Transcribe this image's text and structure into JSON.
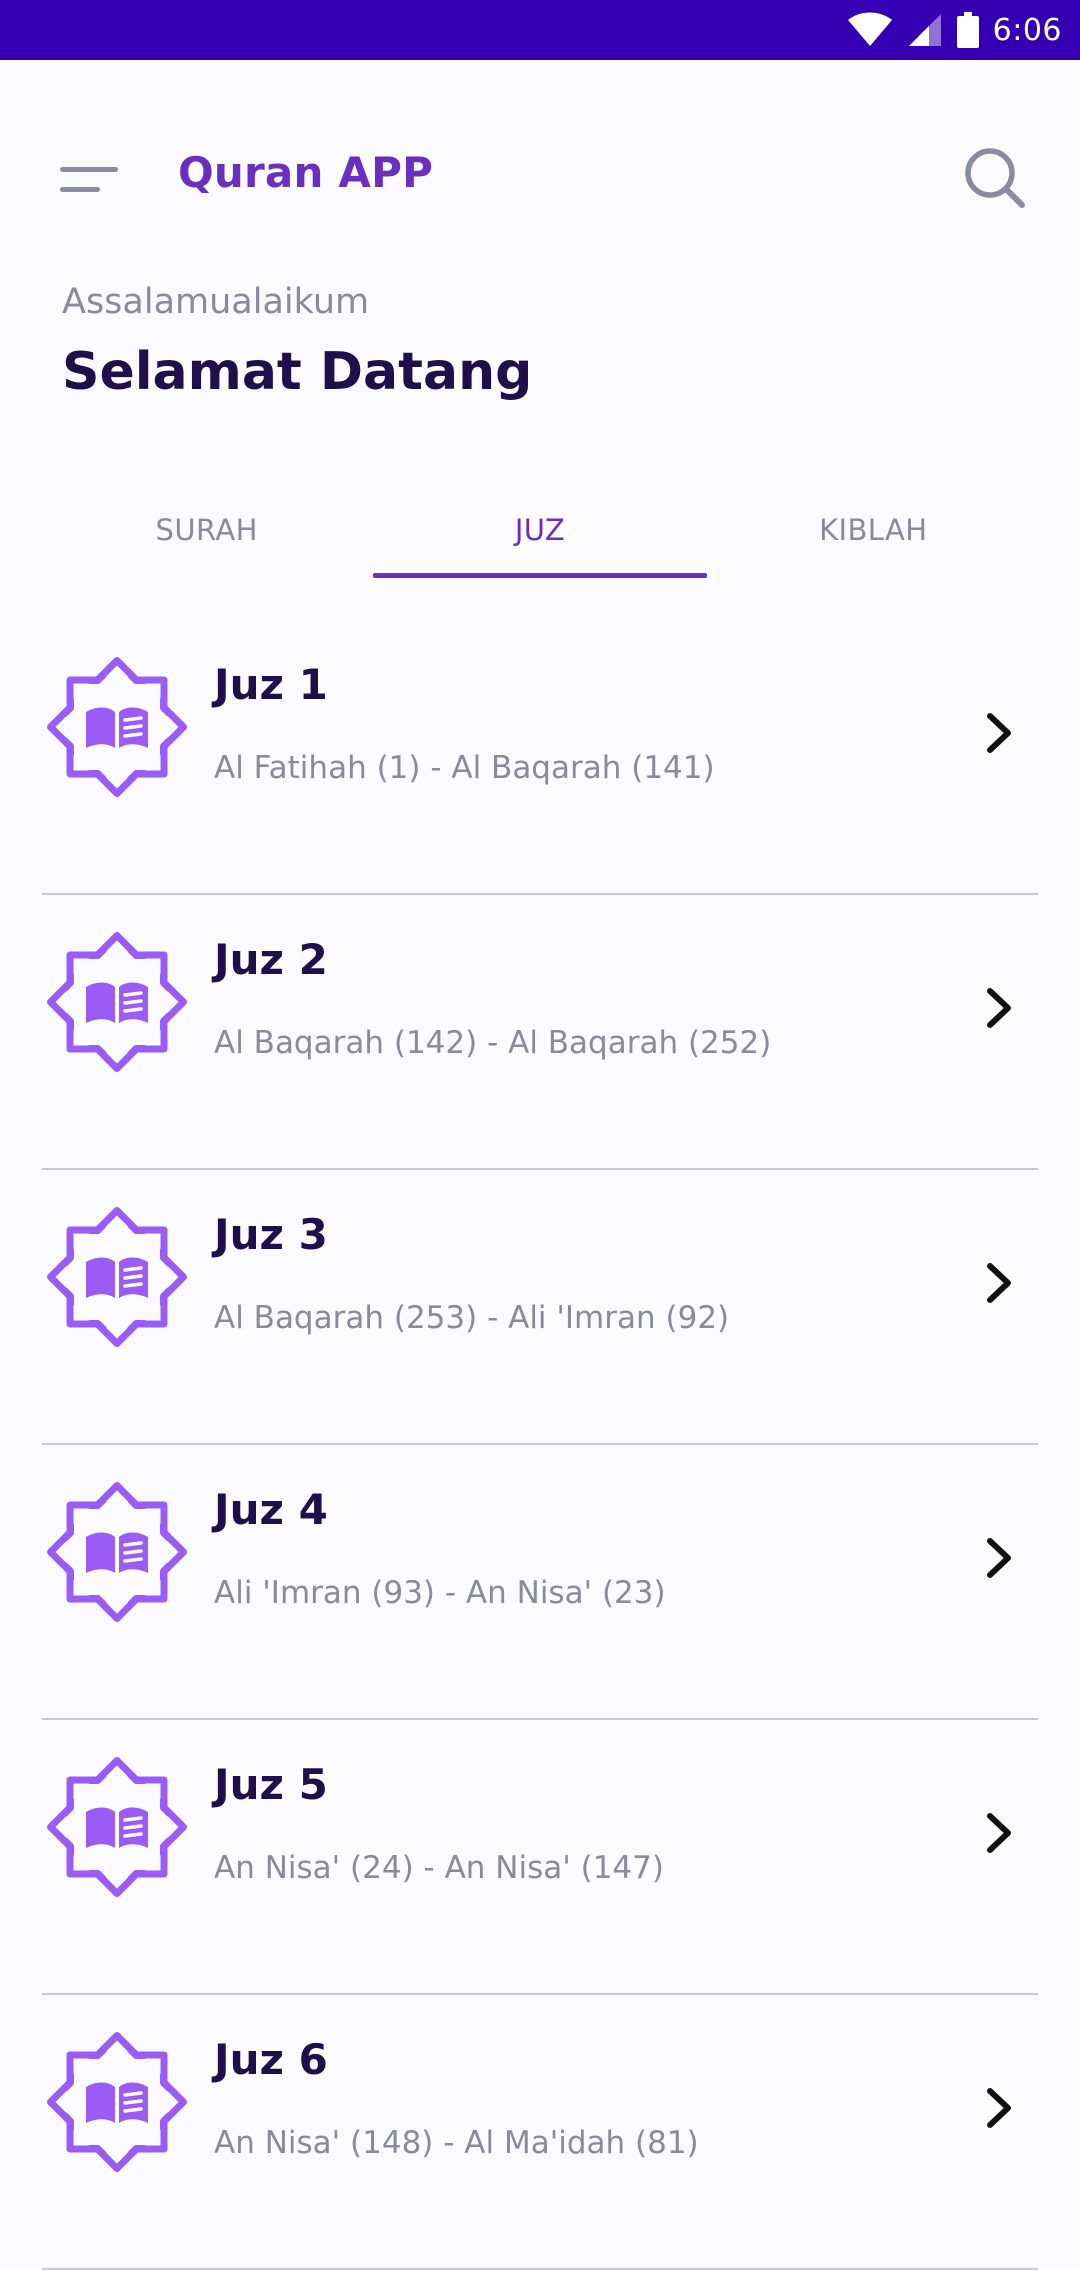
{
  "status_bar": {
    "time": "6:06",
    "icons": [
      "wifi-icon",
      "signal-icon",
      "battery-icon"
    ]
  },
  "header": {
    "title": "Quran APP",
    "greeting": "Assalamualaikum",
    "welcome": "Selamat Datang",
    "menu_icon": "menu-icon",
    "search_icon": "search-icon"
  },
  "tabs": [
    {
      "label": "SURAH",
      "active": false
    },
    {
      "label": "JUZ",
      "active": true
    },
    {
      "label": "KIBLAH",
      "active": false
    }
  ],
  "juz_list": [
    {
      "title": "Juz 1",
      "range": "Al Fatihah (1) - Al Baqarah (141)"
    },
    {
      "title": "Juz 2",
      "range": "Al Baqarah (142) - Al Baqarah (252)"
    },
    {
      "title": "Juz 3",
      "range": "Al Baqarah (253) - Ali 'Imran (92)"
    },
    {
      "title": "Juz 4",
      "range": "Ali 'Imran (93) - An Nisa' (23)"
    },
    {
      "title": "Juz 5",
      "range": "An Nisa' (24) - An Nisa' (147)"
    },
    {
      "title": "Juz 6",
      "range": "An Nisa' (148) - Al Ma'idah (81)"
    }
  ],
  "colors": {
    "status_bar": "#3500b3",
    "accent": "#6a2fc0",
    "badge": "#9a5cf5",
    "title_text": "#1f0f4a",
    "muted_text": "#8a8a9b"
  }
}
